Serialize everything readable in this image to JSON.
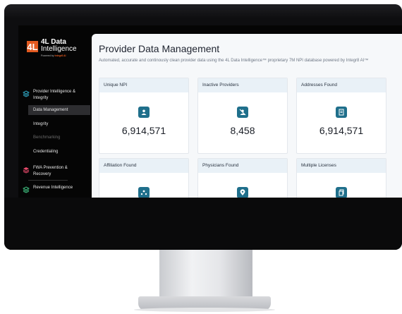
{
  "brand": {
    "logo_mark": "4L",
    "name_line1": "4L Data",
    "name_line2": "Intelligence",
    "powered_by": "Powered by",
    "powered_brand": "Integr8 AI"
  },
  "sidebar": {
    "groups": [
      {
        "label": "Provider Intelligence & Integrity",
        "icon": "layers-icon",
        "expanded": true,
        "items": [
          {
            "label": "Data Management",
            "active": true
          },
          {
            "label": "Integrity",
            "active": false
          },
          {
            "label": "Benchmarking",
            "active": false,
            "disabled": true
          },
          {
            "label": "Credentialing",
            "active": false
          }
        ]
      },
      {
        "label": "FWA Prevention & Recovery",
        "icon": "shield-layers-icon",
        "expanded": false
      },
      {
        "label": "Revenue Intelligence",
        "icon": "stack-icon",
        "expanded": false
      }
    ]
  },
  "main": {
    "title": "Provider Data Management",
    "description": "Automated, accurate and continously clean provider data using the 4L Data Intelligence™ proprietary 7M NPI database powered by Integr8 AI™",
    "cards": [
      {
        "title": "Unique NPI",
        "value": "6,914,571",
        "icon": "person-icon"
      },
      {
        "title": "Inactive Providers",
        "value": "8,458",
        "icon": "person-off-icon"
      },
      {
        "title": "Addresses Found",
        "value": "6,914,571",
        "icon": "document-icon"
      },
      {
        "title": "Affiliation Found",
        "value": "",
        "icon": "network-icon"
      },
      {
        "title": "Physicians Found",
        "value": "",
        "icon": "location-pin-icon"
      },
      {
        "title": "Multiple Licenses",
        "value": "",
        "icon": "copy-icon"
      }
    ]
  },
  "colors": {
    "accent": "#1f6f8b",
    "brand_orange": "#e2591f",
    "card_header": "#e9f1f7",
    "sidebar_bg": "#050505",
    "icon_green": "#3fbf7f",
    "icon_teal": "#2fa6c2"
  }
}
